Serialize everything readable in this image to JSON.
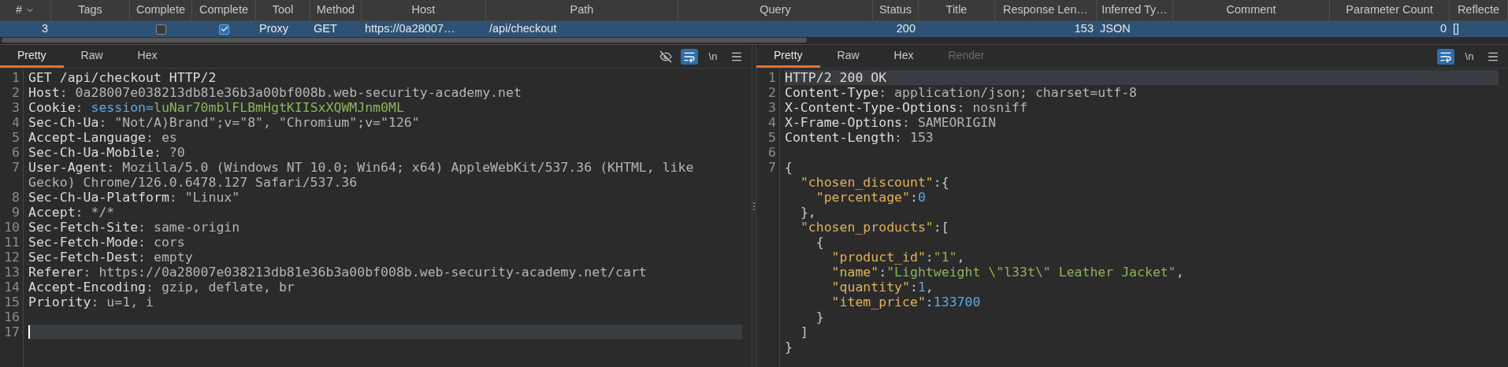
{
  "table": {
    "columns": [
      {
        "label": "#",
        "sort_indicator": true
      },
      {
        "label": "Tags"
      },
      {
        "label": "Complete"
      },
      {
        "label": "Complete"
      },
      {
        "label": "Tool"
      },
      {
        "label": "Method"
      },
      {
        "label": "Host"
      },
      {
        "label": "Path"
      },
      {
        "label": "Query"
      },
      {
        "label": "Status"
      },
      {
        "label": "Title"
      },
      {
        "label": "Response Len…"
      },
      {
        "label": "Inferred Ty…"
      },
      {
        "label": "Comment"
      },
      {
        "label": "Parameter Count"
      },
      {
        "label": "Reflecte"
      }
    ],
    "rows": [
      {
        "selected": true,
        "cells": [
          {
            "kind": "number",
            "text": "3"
          },
          {
            "kind": "empty"
          },
          {
            "kind": "checkbox",
            "checked": false
          },
          {
            "kind": "checkbox",
            "checked": true
          },
          {
            "kind": "text",
            "text": "Proxy"
          },
          {
            "kind": "text",
            "text": "GET"
          },
          {
            "kind": "text",
            "text": "https://0a28007…"
          },
          {
            "kind": "text",
            "text": "/api/checkout"
          },
          {
            "kind": "empty"
          },
          {
            "kind": "number",
            "text": "200"
          },
          {
            "kind": "empty"
          },
          {
            "kind": "number",
            "text": "153"
          },
          {
            "kind": "text",
            "text": "JSON"
          },
          {
            "kind": "empty"
          },
          {
            "kind": "number",
            "text": "0"
          },
          {
            "kind": "text",
            "text": "[]"
          }
        ]
      }
    ]
  },
  "panes": [
    {
      "tabs": [
        {
          "label": "Pretty",
          "selected": true,
          "disabled": false
        },
        {
          "label": "Raw",
          "selected": false,
          "disabled": false
        },
        {
          "label": "Hex",
          "selected": false,
          "disabled": false
        }
      ],
      "tools": [
        {
          "kind": "hide",
          "on": false
        },
        {
          "kind": "wrap",
          "on": true
        },
        {
          "kind": "newline",
          "label": "\\n",
          "on": false
        },
        {
          "kind": "menu",
          "on": false
        }
      ],
      "lines": [
        {
          "n": "1",
          "tokens": [
            {
              "kind": "name",
              "t": "GET /api/checkout HTTP/2"
            }
          ]
        },
        {
          "n": "2",
          "tokens": [
            {
              "kind": "name",
              "t": "Host"
            },
            {
              "kind": "value",
              "t": ": 0a28007e038213db81e36b3a00bf008b.web-security-academy.net"
            }
          ]
        },
        {
          "n": "3",
          "tokens": [
            {
              "kind": "name",
              "t": "Cookie"
            },
            {
              "kind": "value",
              "t": ": "
            },
            {
              "kind": "param",
              "t": "session="
            },
            {
              "kind": "string",
              "t": "luNar70mblFLBmHgtKIISxXQWMJnm0ML"
            }
          ]
        },
        {
          "n": "4",
          "tokens": [
            {
              "kind": "name",
              "t": "Sec-Ch-Ua"
            },
            {
              "kind": "value",
              "t": ": \"Not/A)Brand\";v=\"8\", \"Chromium\";v=\"126\""
            }
          ]
        },
        {
          "n": "5",
          "tokens": [
            {
              "kind": "name",
              "t": "Accept-Language"
            },
            {
              "kind": "value",
              "t": ": es"
            }
          ]
        },
        {
          "n": "6",
          "tokens": [
            {
              "kind": "name",
              "t": "Sec-Ch-Ua-Mobile"
            },
            {
              "kind": "value",
              "t": ": ?0"
            }
          ]
        },
        {
          "n": "7",
          "tokens": [
            {
              "kind": "name",
              "t": "User-Agent"
            },
            {
              "kind": "value",
              "t": ": Mozilla/5.0 (Windows NT 10.0; Win64; x64) AppleWebKit/537.36 (KHTML, like Gecko) Chrome/126.0.6478.127 Safari/537.36"
            }
          ]
        },
        {
          "n": "8",
          "tokens": [
            {
              "kind": "name",
              "t": "Sec-Ch-Ua-Platform"
            },
            {
              "kind": "value",
              "t": ": \"Linux\""
            }
          ]
        },
        {
          "n": "9",
          "tokens": [
            {
              "kind": "name",
              "t": "Accept"
            },
            {
              "kind": "value",
              "t": ": */*"
            }
          ]
        },
        {
          "n": "10",
          "tokens": [
            {
              "kind": "name",
              "t": "Sec-Fetch-Site"
            },
            {
              "kind": "value",
              "t": ": same-origin"
            }
          ]
        },
        {
          "n": "11",
          "tokens": [
            {
              "kind": "name",
              "t": "Sec-Fetch-Mode"
            },
            {
              "kind": "value",
              "t": ": cors"
            }
          ]
        },
        {
          "n": "12",
          "tokens": [
            {
              "kind": "name",
              "t": "Sec-Fetch-Dest"
            },
            {
              "kind": "value",
              "t": ": empty"
            }
          ]
        },
        {
          "n": "13",
          "tokens": [
            {
              "kind": "name",
              "t": "Referer"
            },
            {
              "kind": "value",
              "t": ": https://0a28007e038213db81e36b3a00bf008b.web-security-academy.net/cart"
            }
          ]
        },
        {
          "n": "14",
          "tokens": [
            {
              "kind": "name",
              "t": "Accept-Encoding"
            },
            {
              "kind": "value",
              "t": ": gzip, deflate, br"
            }
          ]
        },
        {
          "n": "15",
          "tokens": [
            {
              "kind": "name",
              "t": "Priority"
            },
            {
              "kind": "value",
              "t": ": u=1, i"
            }
          ]
        },
        {
          "n": "16"
        },
        {
          "n": "17",
          "highlighted": true,
          "cursor": true
        }
      ]
    },
    {
      "tabs": [
        {
          "label": "Pretty",
          "selected": true,
          "disabled": false
        },
        {
          "label": "Raw",
          "selected": false,
          "disabled": false
        },
        {
          "label": "Hex",
          "selected": false,
          "disabled": false
        },
        {
          "label": "Render",
          "selected": false,
          "disabled": true
        }
      ],
      "tools": [
        {
          "kind": "wrap",
          "on": true
        },
        {
          "kind": "newline",
          "label": "\\n",
          "on": false
        },
        {
          "kind": "menu",
          "on": false
        }
      ],
      "lines": [
        {
          "n": "1",
          "highlighted": true,
          "tokens": [
            {
              "kind": "name",
              "t": "HTTP/2 200 OK"
            }
          ]
        },
        {
          "n": "2",
          "tokens": [
            {
              "kind": "name",
              "t": "Content-Type"
            },
            {
              "kind": "value",
              "t": ": application/json; charset=utf-8"
            }
          ]
        },
        {
          "n": "3",
          "tokens": [
            {
              "kind": "name",
              "t": "X-Content-Type-Options"
            },
            {
              "kind": "value",
              "t": ": nosniff"
            }
          ]
        },
        {
          "n": "4",
          "tokens": [
            {
              "kind": "name",
              "t": "X-Frame-Options"
            },
            {
              "kind": "value",
              "t": ": SAMEORIGIN"
            }
          ]
        },
        {
          "n": "5",
          "tokens": [
            {
              "kind": "name",
              "t": "Content-Length"
            },
            {
              "kind": "value",
              "t": ": 153"
            }
          ]
        },
        {
          "n": "6"
        },
        {
          "n": "7",
          "tokens": [
            {
              "kind": "punct",
              "t": "{"
            }
          ]
        },
        {
          "tokens": [
            {
              "kind": "key",
              "t": "  \"chosen_discount\""
            },
            {
              "kind": "punct",
              "t": ":{"
            }
          ]
        },
        {
          "tokens": [
            {
              "kind": "key",
              "t": "    \"percentage\""
            },
            {
              "kind": "punct",
              "t": ":"
            },
            {
              "kind": "number",
              "t": "0"
            }
          ]
        },
        {
          "tokens": [
            {
              "kind": "punct",
              "t": "  },"
            }
          ]
        },
        {
          "tokens": [
            {
              "kind": "key",
              "t": "  \"chosen_products\""
            },
            {
              "kind": "punct",
              "t": ":["
            }
          ]
        },
        {
          "tokens": [
            {
              "kind": "punct",
              "t": "    {"
            }
          ]
        },
        {
          "tokens": [
            {
              "kind": "key",
              "t": "      \"product_id\""
            },
            {
              "kind": "punct",
              "t": ":"
            },
            {
              "kind": "string",
              "t": "\"1\""
            },
            {
              "kind": "punct",
              "t": ","
            }
          ]
        },
        {
          "tokens": [
            {
              "kind": "key",
              "t": "      \"name\""
            },
            {
              "kind": "punct",
              "t": ":"
            },
            {
              "kind": "string",
              "t": "\"Lightweight \\\"l33t\\\" Leather Jacket\""
            },
            {
              "kind": "punct",
              "t": ","
            }
          ]
        },
        {
          "tokens": [
            {
              "kind": "key",
              "t": "      \"quantity\""
            },
            {
              "kind": "punct",
              "t": ":"
            },
            {
              "kind": "number",
              "t": "1"
            },
            {
              "kind": "punct",
              "t": ","
            }
          ]
        },
        {
          "tokens": [
            {
              "kind": "key",
              "t": "      \"item_price\""
            },
            {
              "kind": "punct",
              "t": ":"
            },
            {
              "kind": "number",
              "t": "133700"
            }
          ]
        },
        {
          "tokens": [
            {
              "kind": "punct",
              "t": "    }"
            }
          ]
        },
        {
          "tokens": [
            {
              "kind": "punct",
              "t": "  ]"
            }
          ]
        },
        {
          "tokens": [
            {
              "kind": "punct",
              "t": "}"
            }
          ]
        }
      ]
    }
  ]
}
